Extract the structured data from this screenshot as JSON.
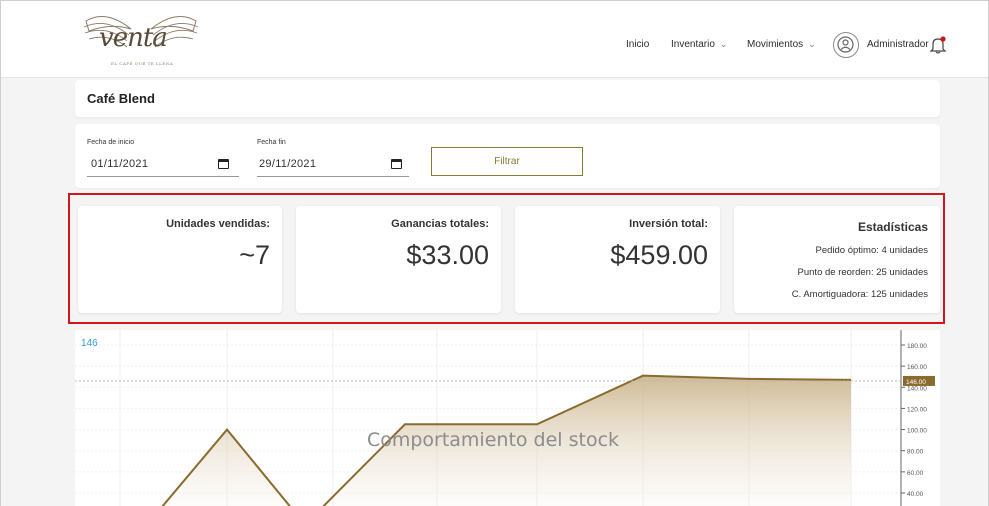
{
  "brand": {
    "logo_text": "venta",
    "logo_tagline": "EL CAFÉ QUE TE LLENA"
  },
  "nav": {
    "inicio": "Inicio",
    "inventario": "Inventario",
    "movimientos": "Movimientos",
    "user": "Administrador"
  },
  "product": {
    "title": "Café Blend"
  },
  "filter": {
    "start_label": "Fecha de inicio",
    "start_value": "01/11/2021",
    "end_label": "Fecha fin",
    "end_value": "29/11/2021",
    "button": "Filtrar"
  },
  "stats": {
    "units_label": "Unidades vendidas:",
    "units_value": "~7",
    "profit_label": "Ganancias totales:",
    "profit_value": "$33.00",
    "investment_label": "Inversión total:",
    "investment_value": "$459.00",
    "statistics_title": "Estadísticas",
    "optimal_order": "Pedido óptimo: 4 unidades",
    "reorder_point": "Punto de reorden: 25 unidades",
    "buffer": "C. Amortiguadora: 125 unidades"
  },
  "colors": {
    "accent": "#8a7a3a",
    "highlight": "#d0161e",
    "chart_line": "#8b6a2e",
    "chart_fill_top": "#c9b38a",
    "ref_label": "#2a9fd6"
  },
  "chart_data": {
    "type": "area",
    "title": "Comportamiento del stock",
    "ref_label": "146",
    "ref_value": 146,
    "ylim": [
      30,
      190
    ],
    "y_ticks": [
      "180.00",
      "160.00",
      "140.00",
      "120.00",
      "100.00",
      "80.00",
      "60.00",
      "40.00"
    ],
    "y_tick_values": [
      180,
      160,
      140,
      120,
      100,
      80,
      60,
      40
    ],
    "current_label": "146.00",
    "x": [
      0,
      1,
      2,
      3,
      4,
      5,
      6,
      7
    ],
    "values": [
      10,
      100,
      10,
      105,
      105,
      151,
      148,
      147
    ]
  }
}
